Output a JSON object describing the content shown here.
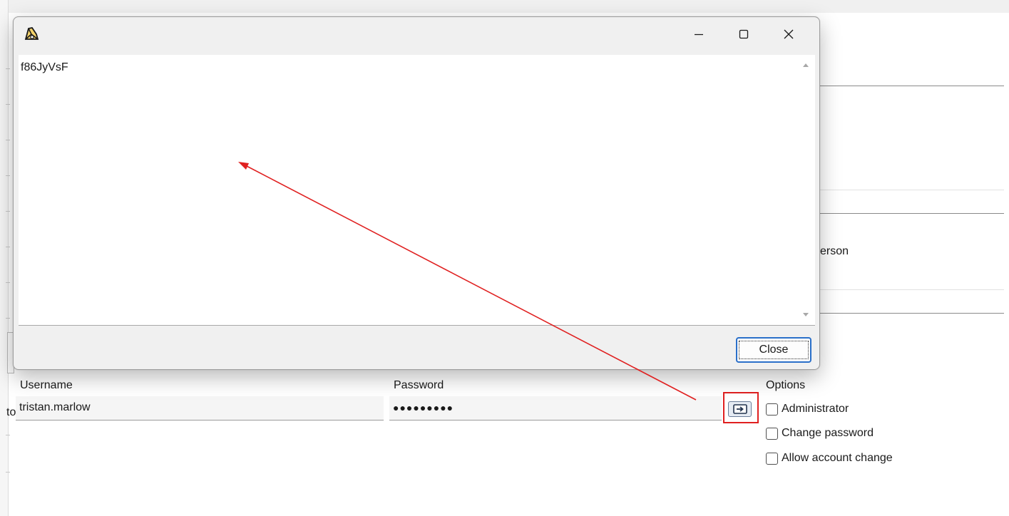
{
  "background_window": {
    "partial_label_person": "erson",
    "partial_label_left": "to"
  },
  "form": {
    "username_label": "Username",
    "username_value": "tristan.marlow",
    "password_label": "Password",
    "password_masked": "●●●●●●●●●",
    "options_label": "Options",
    "options": [
      {
        "label": "Administrator",
        "checked": false
      },
      {
        "label": "Change password",
        "checked": false
      },
      {
        "label": "Allow account change",
        "checked": false
      }
    ]
  },
  "dialog": {
    "title": "",
    "content": "f86JyVsF",
    "close_label": "Close",
    "window_controls": [
      "minimize-icon",
      "maximize-icon",
      "close-icon"
    ]
  },
  "annotations": {
    "highlight_color": "#e02020",
    "arrow_color": "#e02020"
  },
  "colors": {
    "accent": "#2a6fc9",
    "dialog_bg": "#f0f0f0",
    "input_bg": "#f5f5f5"
  }
}
